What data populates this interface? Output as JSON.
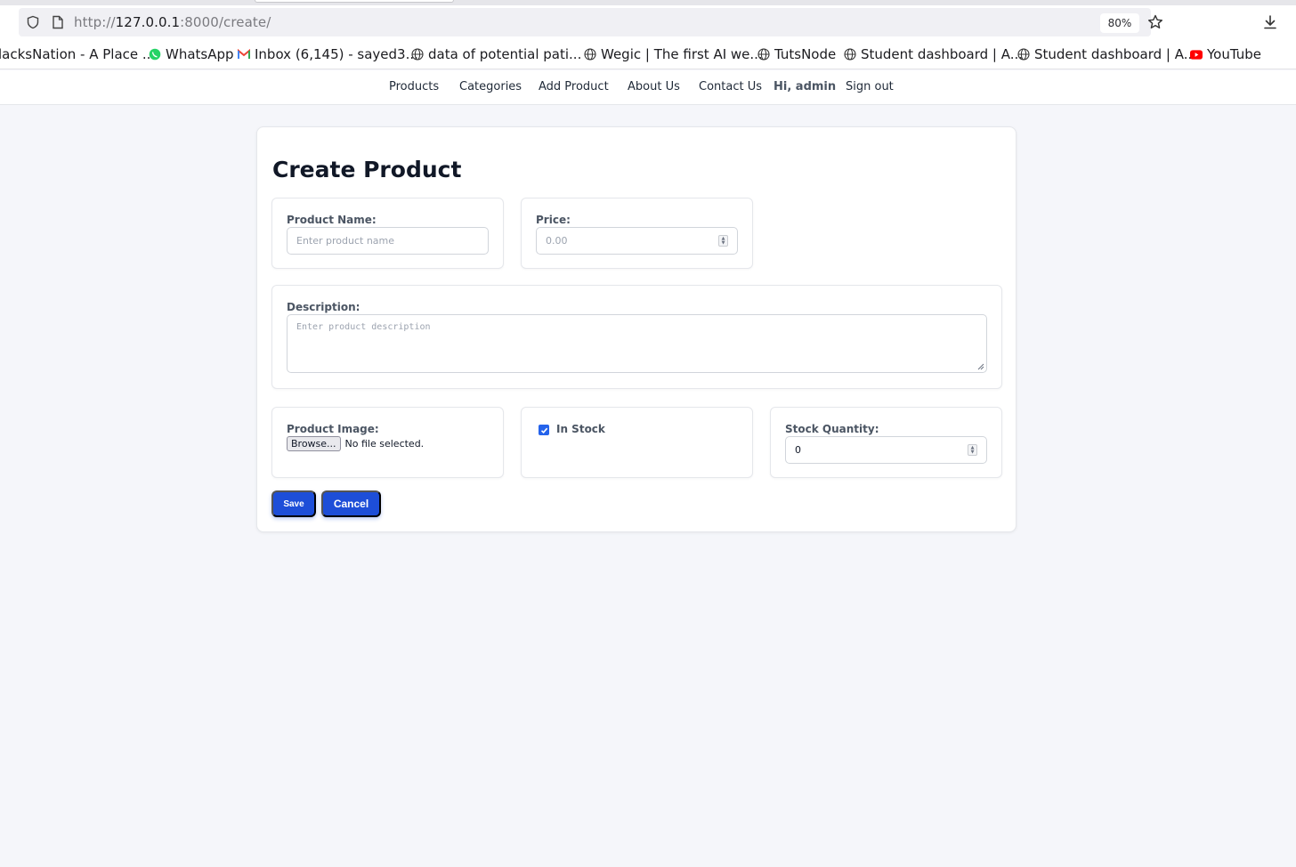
{
  "browser": {
    "url_prefix": "http://",
    "url_host": "127.0.0.1",
    "url_path": ":8000/create/",
    "zoom": "80%"
  },
  "bookmarks": [
    {
      "label": "lacksNation - A Place ...",
      "icon": "none"
    },
    {
      "label": "WhatsApp",
      "icon": "whatsapp-icon"
    },
    {
      "label": "Inbox (6,145) - sayed3...",
      "icon": "gmail-icon"
    },
    {
      "label": "data of potential pati...",
      "icon": "globe-icon"
    },
    {
      "label": "Wegic | The first AI we...",
      "icon": "globe-icon"
    },
    {
      "label": "TutsNode",
      "icon": "globe-icon"
    },
    {
      "label": "Student dashboard | A...",
      "icon": "globe-icon"
    },
    {
      "label": "Student dashboard | A...",
      "icon": "globe-icon"
    },
    {
      "label": "YouTube",
      "icon": "youtube-icon"
    }
  ],
  "nav": {
    "products": "Products",
    "categories": "Categories",
    "add_product": "Add Product",
    "about": "About Us",
    "contact": "Contact Us",
    "greeting": "Hi, admin",
    "signout": "Sign out"
  },
  "form": {
    "title": "Create Product",
    "product_name_label": "Product Name:",
    "product_name_placeholder": "Enter product name",
    "price_label": "Price:",
    "price_placeholder": "0.00",
    "description_label": "Description:",
    "description_placeholder": "Enter product description",
    "image_label": "Product Image:",
    "browse_label": "Browse...",
    "no_file_text": "No file selected.",
    "in_stock_label": "In Stock",
    "in_stock_checked": true,
    "stock_qty_label": "Stock Quantity:",
    "stock_qty_value": "0",
    "save_label": "Save",
    "cancel_label": "Cancel"
  },
  "colors": {
    "accent": "#1d4ed8",
    "checkbox": "#2563eb",
    "page_bg": "#f5f6fa"
  }
}
